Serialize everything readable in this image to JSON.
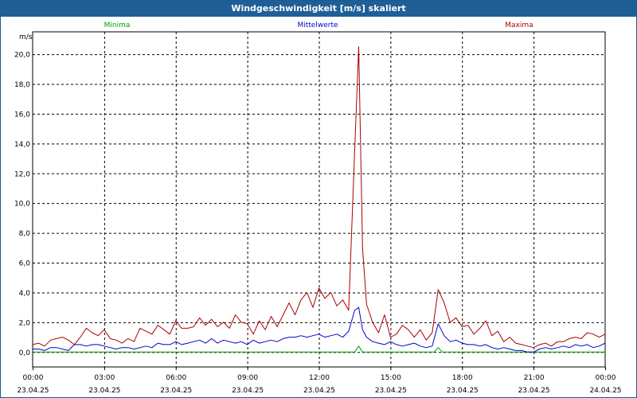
{
  "window": {
    "title": "Windgeschwindigkeit [m/s] skaliert"
  },
  "chart_data": {
    "type": "line",
    "title": "Windgeschwindigkeit [m/s] skaliert",
    "ylabel": "m/s",
    "xlabel": "",
    "ylim": [
      -1.0,
      21.5
    ],
    "xlim": [
      0,
      24
    ],
    "grid": true,
    "legend_position": "top",
    "y_tick_values": [
      0,
      2,
      4,
      6,
      8,
      10,
      12,
      14,
      16,
      18,
      20
    ],
    "y_tick_labels": [
      "0,0",
      "2,0",
      "4,0",
      "6,0",
      "8,0",
      "10,0",
      "12,0",
      "14,0",
      "16,0",
      "18,0",
      "20,0"
    ],
    "x_tick_values": [
      0,
      3,
      6,
      9,
      12,
      15,
      18,
      21,
      24
    ],
    "x_tick_times": [
      "00:00",
      "03:00",
      "06:00",
      "09:00",
      "12:00",
      "15:00",
      "18:00",
      "21:00",
      "00:00"
    ],
    "x_tick_dates": [
      "23.04.25",
      "23.04.25",
      "23.04.25",
      "23.04.25",
      "23.04.25",
      "23.04.25",
      "23.04.25",
      "23.04.25",
      "24.04.25"
    ],
    "series": [
      {
        "name": "Minima",
        "color": "#00a000",
        "x": [
          0,
          13.5,
          13.67,
          13.83,
          16.83,
          17.0,
          17.17,
          24
        ],
        "values": [
          0,
          0,
          0.4,
          0,
          0,
          0.3,
          0,
          0
        ]
      },
      {
        "name": "Mittelwerte",
        "color": "#0000cc",
        "x": [
          0,
          0.25,
          0.5,
          0.75,
          1.0,
          1.25,
          1.5,
          1.75,
          2.0,
          2.25,
          2.5,
          2.75,
          3.0,
          3.25,
          3.5,
          3.75,
          4.0,
          4.25,
          4.5,
          4.75,
          5.0,
          5.25,
          5.5,
          5.75,
          6.0,
          6.25,
          6.5,
          6.75,
          7.0,
          7.25,
          7.5,
          7.75,
          8.0,
          8.25,
          8.5,
          8.75,
          9.0,
          9.25,
          9.5,
          9.75,
          10.0,
          10.25,
          10.5,
          10.75,
          11.0,
          11.25,
          11.5,
          11.75,
          12.0,
          12.25,
          12.5,
          12.75,
          13.0,
          13.25,
          13.5,
          13.67,
          13.83,
          14.0,
          14.25,
          14.5,
          14.75,
          15.0,
          15.25,
          15.5,
          15.75,
          16.0,
          16.25,
          16.5,
          16.75,
          17.0,
          17.25,
          17.5,
          17.75,
          18.0,
          18.25,
          18.5,
          18.75,
          19.0,
          19.25,
          19.5,
          19.75,
          20.0,
          20.25,
          20.5,
          20.75,
          21.0,
          21.25,
          21.5,
          21.75,
          22.0,
          22.25,
          22.5,
          22.75,
          23.0,
          23.25,
          23.5,
          23.75,
          24.0
        ],
        "values": [
          0.2,
          0.2,
          0.1,
          0.3,
          0.3,
          0.2,
          0.1,
          0.5,
          0.5,
          0.4,
          0.5,
          0.5,
          0.4,
          0.3,
          0.2,
          0.3,
          0.3,
          0.2,
          0.3,
          0.4,
          0.3,
          0.6,
          0.5,
          0.5,
          0.7,
          0.5,
          0.6,
          0.7,
          0.8,
          0.6,
          0.9,
          0.6,
          0.8,
          0.7,
          0.6,
          0.7,
          0.5,
          0.8,
          0.6,
          0.7,
          0.8,
          0.7,
          0.9,
          1.0,
          1.0,
          1.1,
          1.0,
          1.1,
          1.2,
          1.0,
          1.1,
          1.2,
          1.0,
          1.4,
          2.8,
          3.0,
          1.5,
          1.0,
          0.7,
          0.6,
          0.5,
          0.7,
          0.5,
          0.4,
          0.5,
          0.6,
          0.4,
          0.3,
          0.4,
          1.9,
          1.1,
          0.7,
          0.8,
          0.6,
          0.5,
          0.5,
          0.4,
          0.5,
          0.3,
          0.2,
          0.3,
          0.2,
          0.1,
          0.1,
          0.0,
          0.0,
          0.2,
          0.3,
          0.2,
          0.3,
          0.4,
          0.3,
          0.5,
          0.4,
          0.5,
          0.3,
          0.4,
          0.6
        ]
      },
      {
        "name": "Maxima",
        "color": "#aa0000",
        "x": [
          0,
          0.25,
          0.5,
          0.75,
          1.0,
          1.25,
          1.5,
          1.75,
          2.0,
          2.25,
          2.5,
          2.75,
          3.0,
          3.25,
          3.5,
          3.75,
          4.0,
          4.25,
          4.5,
          4.75,
          5.0,
          5.25,
          5.5,
          5.75,
          6.0,
          6.25,
          6.5,
          6.75,
          7.0,
          7.25,
          7.5,
          7.75,
          8.0,
          8.25,
          8.5,
          8.75,
          9.0,
          9.25,
          9.5,
          9.75,
          10.0,
          10.25,
          10.5,
          10.75,
          11.0,
          11.25,
          11.5,
          11.75,
          12.0,
          12.25,
          12.5,
          12.75,
          13.0,
          13.25,
          13.5,
          13.67,
          13.83,
          14.0,
          14.25,
          14.5,
          14.75,
          15.0,
          15.25,
          15.5,
          15.75,
          16.0,
          16.25,
          16.5,
          16.75,
          17.0,
          17.25,
          17.5,
          17.75,
          18.0,
          18.25,
          18.5,
          18.75,
          19.0,
          19.25,
          19.5,
          19.75,
          20.0,
          20.25,
          20.5,
          20.75,
          21.0,
          21.25,
          21.5,
          21.75,
          22.0,
          22.25,
          22.5,
          22.75,
          23.0,
          23.25,
          23.5,
          23.75,
          24.0
        ],
        "values": [
          0.5,
          0.6,
          0.4,
          0.8,
          0.9,
          1.0,
          0.8,
          0.5,
          1.0,
          1.6,
          1.3,
          1.1,
          1.5,
          0.9,
          0.8,
          0.6,
          0.9,
          0.7,
          1.6,
          1.4,
          1.2,
          1.8,
          1.5,
          1.2,
          2.1,
          1.6,
          1.6,
          1.7,
          2.3,
          1.8,
          2.2,
          1.7,
          2.0,
          1.6,
          2.5,
          2.0,
          1.9,
          1.2,
          2.1,
          1.5,
          2.4,
          1.7,
          2.5,
          3.3,
          2.5,
          3.5,
          4.0,
          3.0,
          4.3,
          3.6,
          4.0,
          3.1,
          3.5,
          2.8,
          13.5,
          20.5,
          7.0,
          3.2,
          2.0,
          1.3,
          2.5,
          1.0,
          1.2,
          1.8,
          1.5,
          1.0,
          1.5,
          0.8,
          1.3,
          4.2,
          3.3,
          2.0,
          2.3,
          1.7,
          1.8,
          1.2,
          1.6,
          2.1,
          1.1,
          1.4,
          0.7,
          1.0,
          0.6,
          0.5,
          0.4,
          0.3,
          0.5,
          0.6,
          0.4,
          0.7,
          0.7,
          0.9,
          1.0,
          0.9,
          1.3,
          1.2,
          1.0,
          1.2
        ]
      }
    ]
  }
}
